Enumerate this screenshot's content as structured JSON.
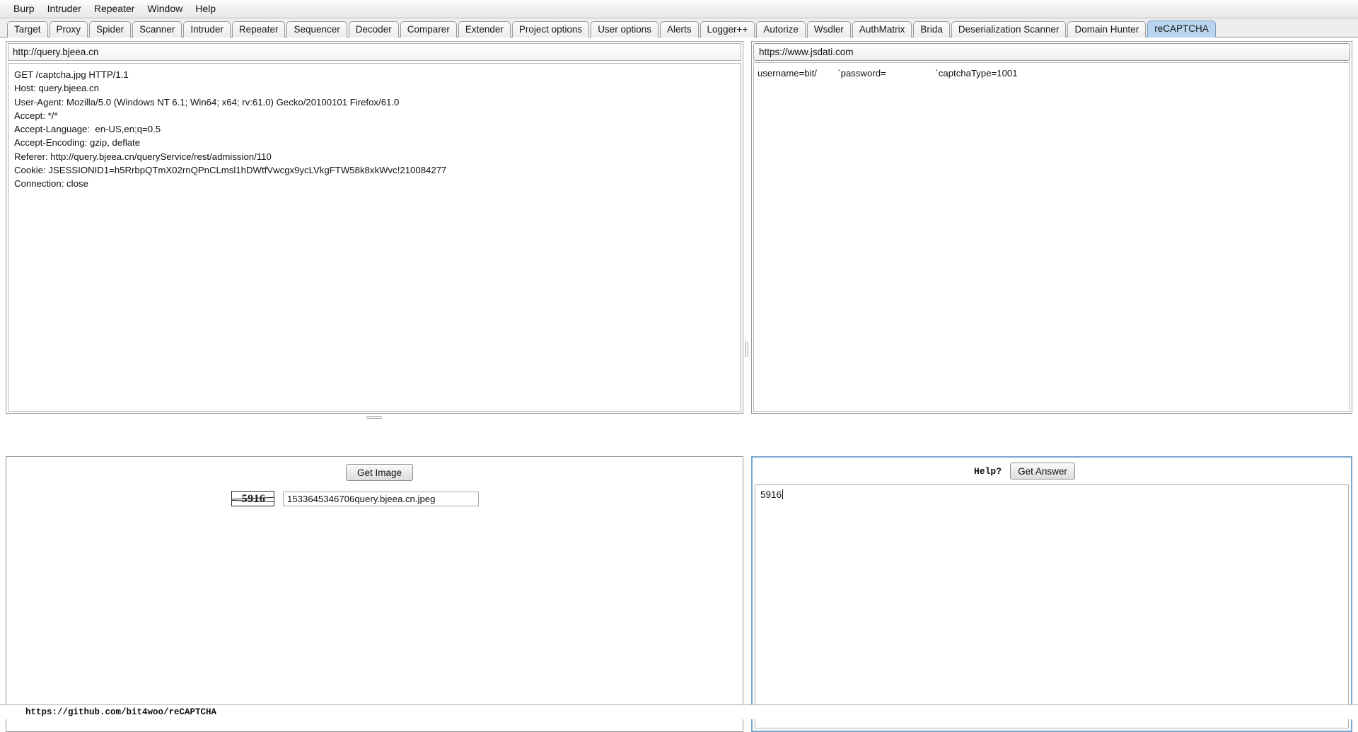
{
  "menubar": {
    "items": [
      {
        "label": "Burp"
      },
      {
        "label": "Intruder"
      },
      {
        "label": "Repeater"
      },
      {
        "label": "Window"
      },
      {
        "label": "Help"
      }
    ]
  },
  "tabbar": {
    "active": "reCAPTCHA",
    "active_color": "#b8d4ee",
    "tabs": [
      {
        "label": "Target"
      },
      {
        "label": "Proxy"
      },
      {
        "label": "Spider"
      },
      {
        "label": "Scanner"
      },
      {
        "label": "Intruder"
      },
      {
        "label": "Repeater"
      },
      {
        "label": "Sequencer"
      },
      {
        "label": "Decoder"
      },
      {
        "label": "Comparer"
      },
      {
        "label": "Extender"
      },
      {
        "label": "Project options"
      },
      {
        "label": "User options"
      },
      {
        "label": "Alerts"
      },
      {
        "label": "Logger++"
      },
      {
        "label": "Autorize"
      },
      {
        "label": "Wsdler"
      },
      {
        "label": "AuthMatrix"
      },
      {
        "label": "Brida"
      },
      {
        "label": "Deserialization Scanner"
      },
      {
        "label": "Domain Hunter"
      },
      {
        "label": "reCAPTCHA"
      }
    ]
  },
  "request_panel": {
    "url": "http://query.bjeea.cn",
    "lines": [
      "GET /captcha.jpg HTTP/1.1",
      "Host: query.bjeea.cn",
      "User-Agent: Mozilla/5.0 (Windows NT 6.1; Win64; x64; rv:61.0) Gecko/20100101 Firefox/61.0",
      "Accept: */*",
      "Accept-Language:  en-US,en;q=0.5",
      "Accept-Encoding: gzip, deflate",
      "Referer: http://query.bjeea.cn/queryService/rest/admission/110",
      "Cookie: JSESSIONID1=h5RrbpQTmX02rnQPnCLmsl1hDWtfVwcgx9ycLVkgFTW58k8xkWvc!210084277",
      "Connection: close"
    ]
  },
  "account_panel": {
    "selected": "https://www.jsdati.com",
    "rows": [
      "username=bit/        `password=                   `captchaType=1001"
    ]
  },
  "image_panel": {
    "get_image_label": "Get Image",
    "captcha_text": "5916",
    "filename_value": "1533645346706query.bjeea.cn.jpeg"
  },
  "answer_panel": {
    "help_label": "Help?",
    "get_answer_label": "Get Answer",
    "answer_value": "5916"
  },
  "statusbar": {
    "link": "https://github.com/bit4woo/reCAPTCHA"
  }
}
